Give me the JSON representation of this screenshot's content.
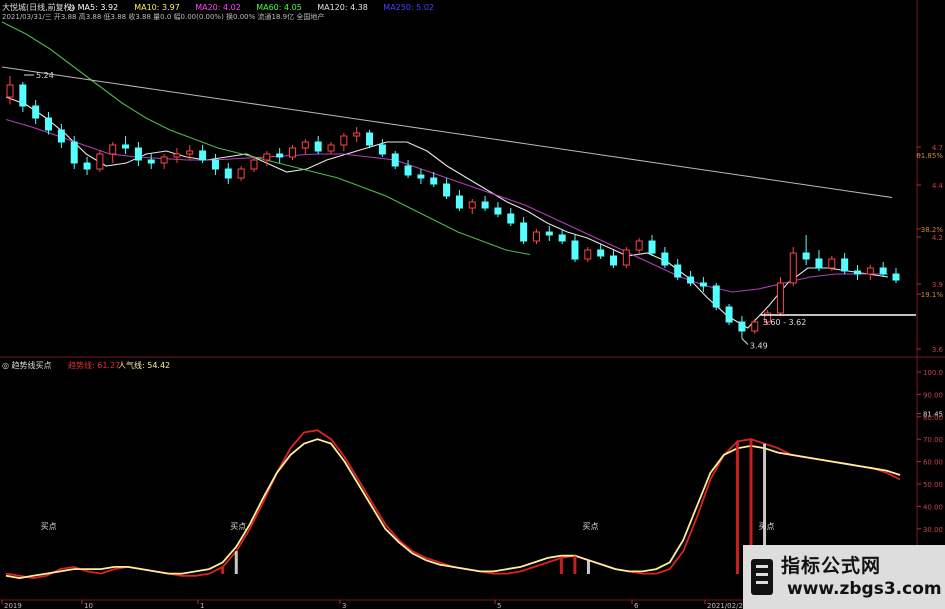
{
  "header": {
    "line1": [
      {
        "text": "大悦城(日线,前复权)",
        "color": "#e0e0e0"
      },
      {
        "text": "◎ MA5: 3.92",
        "color": "#ffffff"
      },
      {
        "text": "MA10: 3.97",
        "color": "#ffee55"
      },
      {
        "text": "MA20: 4.02",
        "color": "#ff44ff"
      },
      {
        "text": "MA60: 4.05",
        "color": "#44ff44"
      },
      {
        "text": "MA120: 4.38",
        "color": "#e0e0e0"
      },
      {
        "text": "MA250: 5.02",
        "color": "#4444ff"
      }
    ],
    "line2": "2021/03/31/三 开3.88 高3.88 低3.88 收3.88 量0.0 幅0.00(0.00%) 换0.00% 流通18.9亿 全国地产"
  },
  "annotations": {
    "high_label": "5.24",
    "low_label": "3.49",
    "range_label": "3.60 - 3.62"
  },
  "right_axis": {
    "price_labels": [
      "4.7",
      "61.85%",
      "4.4",
      "38.2%",
      "4.2",
      "3.9",
      "19.1%",
      "3.6"
    ],
    "osc_labels": [
      "100.0",
      "90.00",
      "81.45",
      "80.00",
      "70.00",
      "60.00",
      "50.00",
      "40.00",
      "30.00",
      "20.00",
      "10.00"
    ]
  },
  "date_axis": [
    "2019",
    "10",
    "1",
    "3",
    "5",
    "6",
    "2021/02/2"
  ],
  "lower_panel": {
    "title": "◎ 趋势线买点",
    "trend_label": "趋势线: 61.27",
    "popularity_label": "人气线: 54.42",
    "buy_label": "买点"
  },
  "watermark": {
    "title": "指标公式网",
    "url": "www.zbgs3.com"
  },
  "colors": {
    "up": "#ff4444",
    "down": "#55ffff",
    "ma5": "#ffffff",
    "ma10": "#ffee55",
    "ma20": "#cc44cc",
    "ma60": "#55cc55",
    "ma120": "#cccccc",
    "trend_line": "#dd2222",
    "popularity_line": "#ffee99"
  },
  "chart_data": [
    {
      "type": "candlestick",
      "title": "大悦城(日线,前复权)",
      "candles": [
        [
          5.1,
          5.24,
          5.05,
          5.18
        ],
        [
          5.18,
          5.2,
          5.0,
          5.04
        ],
        [
          5.04,
          5.08,
          4.92,
          4.96
        ],
        [
          4.96,
          5.0,
          4.85,
          4.88
        ],
        [
          4.88,
          4.92,
          4.76,
          4.8
        ],
        [
          4.8,
          4.84,
          4.62,
          4.66
        ],
        [
          4.66,
          4.7,
          4.58,
          4.62
        ],
        [
          4.62,
          4.74,
          4.6,
          4.72
        ],
        [
          4.72,
          4.8,
          4.66,
          4.78
        ],
        [
          4.78,
          4.84,
          4.72,
          4.76
        ],
        [
          4.76,
          4.8,
          4.64,
          4.68
        ],
        [
          4.68,
          4.72,
          4.62,
          4.66
        ],
        [
          4.66,
          4.72,
          4.62,
          4.7
        ],
        [
          4.7,
          4.76,
          4.66,
          4.72
        ],
        [
          4.72,
          4.78,
          4.68,
          4.74
        ],
        [
          4.74,
          4.78,
          4.66,
          4.68
        ],
        [
          4.68,
          4.72,
          4.58,
          4.62
        ],
        [
          4.62,
          4.66,
          4.52,
          4.56
        ],
        [
          4.56,
          4.64,
          4.54,
          4.62
        ],
        [
          4.62,
          4.7,
          4.6,
          4.68
        ],
        [
          4.68,
          4.74,
          4.64,
          4.72
        ],
        [
          4.72,
          4.76,
          4.66,
          4.7
        ],
        [
          4.7,
          4.78,
          4.68,
          4.76
        ],
        [
          4.76,
          4.82,
          4.72,
          4.8
        ],
        [
          4.8,
          4.84,
          4.72,
          4.74
        ],
        [
          4.74,
          4.8,
          4.72,
          4.78
        ],
        [
          4.78,
          4.86,
          4.74,
          4.84
        ],
        [
          4.84,
          4.9,
          4.8,
          4.86
        ],
        [
          4.86,
          4.88,
          4.76,
          4.78
        ],
        [
          4.78,
          4.82,
          4.7,
          4.72
        ],
        [
          4.72,
          4.74,
          4.62,
          4.64
        ],
        [
          4.64,
          4.68,
          4.56,
          4.58
        ],
        [
          4.58,
          4.62,
          4.52,
          4.56
        ],
        [
          4.56,
          4.6,
          4.5,
          4.52
        ],
        [
          4.52,
          4.56,
          4.42,
          4.44
        ],
        [
          4.44,
          4.48,
          4.34,
          4.36
        ],
        [
          4.36,
          4.42,
          4.32,
          4.4
        ],
        [
          4.4,
          4.44,
          4.34,
          4.36
        ],
        [
          4.36,
          4.4,
          4.3,
          4.32
        ],
        [
          4.32,
          4.36,
          4.24,
          4.26
        ],
        [
          4.26,
          4.3,
          4.12,
          4.14
        ],
        [
          4.14,
          4.22,
          4.12,
          4.2
        ],
        [
          4.2,
          4.24,
          4.14,
          4.18
        ],
        [
          4.18,
          4.22,
          4.12,
          4.14
        ],
        [
          4.14,
          4.18,
          4.0,
          4.02
        ],
        [
          4.02,
          4.1,
          4.0,
          4.08
        ],
        [
          4.08,
          4.12,
          4.02,
          4.04
        ],
        [
          4.04,
          4.08,
          3.96,
          3.98
        ],
        [
          3.98,
          4.1,
          3.96,
          4.08
        ],
        [
          4.08,
          4.16,
          4.06,
          4.14
        ],
        [
          4.14,
          4.18,
          4.04,
          4.06
        ],
        [
          4.06,
          4.1,
          3.96,
          3.98
        ],
        [
          3.98,
          4.02,
          3.88,
          3.9
        ],
        [
          3.9,
          3.94,
          3.84,
          3.86
        ],
        [
          3.86,
          3.9,
          3.8,
          3.84
        ],
        [
          3.84,
          3.86,
          3.68,
          3.7
        ],
        [
          3.7,
          3.72,
          3.58,
          3.6
        ],
        [
          3.6,
          3.64,
          3.49,
          3.54
        ],
        [
          3.54,
          3.62,
          3.52,
          3.6
        ],
        [
          3.6,
          3.68,
          3.58,
          3.66
        ],
        [
          3.66,
          3.9,
          3.64,
          3.86
        ],
        [
          3.86,
          4.1,
          3.84,
          4.06
        ],
        [
          4.06,
          4.18,
          3.98,
          4.02
        ],
        [
          4.02,
          4.08,
          3.94,
          3.96
        ],
        [
          3.96,
          4.04,
          3.94,
          4.02
        ],
        [
          4.02,
          4.06,
          3.92,
          3.94
        ],
        [
          3.94,
          3.98,
          3.88,
          3.92
        ],
        [
          3.92,
          3.98,
          3.88,
          3.96
        ],
        [
          3.96,
          4.0,
          3.9,
          3.92
        ],
        [
          3.92,
          3.96,
          3.86,
          3.88
        ]
      ],
      "ma_lines": {
        "MA5": [
          5.1,
          5.05,
          4.96,
          4.85,
          4.72,
          4.64,
          4.66,
          4.72,
          4.74,
          4.7,
          4.68,
          4.7,
          4.72,
          4.66,
          4.6,
          4.62,
          4.68,
          4.72,
          4.76,
          4.8,
          4.8,
          4.74,
          4.64,
          4.56,
          4.48,
          4.4,
          4.34,
          4.26,
          4.2,
          4.16,
          4.1,
          4.04,
          4.06,
          4.0,
          3.9,
          3.76,
          3.64,
          3.56,
          3.7,
          3.86,
          3.96,
          3.96,
          3.94,
          3.92,
          3.9
        ],
        "MA20": [
          4.95,
          4.9,
          4.84,
          4.78,
          4.72,
          4.7,
          4.69,
          4.68,
          4.68,
          4.69,
          4.7,
          4.71,
          4.72,
          4.72,
          4.7,
          4.68,
          4.62,
          4.56,
          4.5,
          4.44,
          4.38,
          4.3,
          4.22,
          4.14,
          4.06,
          3.98,
          3.9,
          3.84,
          3.8,
          3.82,
          3.86,
          3.9,
          3.92,
          3.92,
          3.92
        ],
        "MA60": [
          5.6,
          5.52,
          5.42,
          5.3,
          5.18,
          5.06,
          4.96,
          4.88,
          4.82,
          4.76,
          4.72,
          4.68,
          4.64,
          4.6,
          4.56,
          4.5,
          4.44,
          4.36,
          4.28,
          4.2,
          4.14,
          4.08,
          4.05
        ],
        "MA120": [
          5.3,
          5.27,
          5.24,
          5.21,
          5.18,
          5.15,
          5.12,
          5.09,
          5.06,
          5.03,
          5.0,
          4.97,
          4.94,
          4.91,
          4.88,
          4.85,
          4.82,
          4.79,
          4.76,
          4.73,
          4.7,
          4.67,
          4.64,
          4.61,
          4.58,
          4.55,
          4.52,
          4.49,
          4.46,
          4.43
        ]
      },
      "ylim": [
        3.4,
        5.6
      ]
    },
    {
      "type": "line",
      "title": "趋势线买点",
      "series": [
        {
          "name": "趋势线",
          "values": [
            10,
            9,
            8,
            9,
            12,
            13,
            11,
            10,
            12,
            13,
            12,
            11,
            10,
            9,
            9,
            10,
            13,
            20,
            30,
            42,
            55,
            66,
            73,
            74,
            70,
            62,
            52,
            42,
            32,
            25,
            20,
            17,
            15,
            13,
            12,
            11,
            10,
            10,
            11,
            13,
            15,
            17,
            18,
            16,
            14,
            12,
            11,
            10,
            10,
            12,
            20,
            35,
            52,
            63,
            69,
            70,
            68,
            66,
            63,
            62,
            61,
            60,
            59,
            58,
            57,
            55,
            52
          ]
        },
        {
          "name": "人气线",
          "values": [
            9,
            8,
            9,
            10,
            11,
            12,
            12,
            12,
            13,
            13,
            12,
            11,
            10,
            10,
            11,
            12,
            15,
            22,
            32,
            44,
            55,
            63,
            68,
            70,
            68,
            60,
            50,
            40,
            30,
            24,
            19,
            16,
            14,
            13,
            12,
            11,
            11,
            12,
            13,
            15,
            17,
            18,
            18,
            16,
            14,
            12,
            11,
            11,
            12,
            15,
            25,
            40,
            55,
            63,
            66,
            67,
            66,
            64,
            63,
            62,
            61,
            60,
            59,
            58,
            57,
            56,
            54
          ]
        }
      ],
      "buy_points": [
        3,
        17,
        43,
        56
      ],
      "ylim": [
        0,
        100
      ]
    }
  ]
}
